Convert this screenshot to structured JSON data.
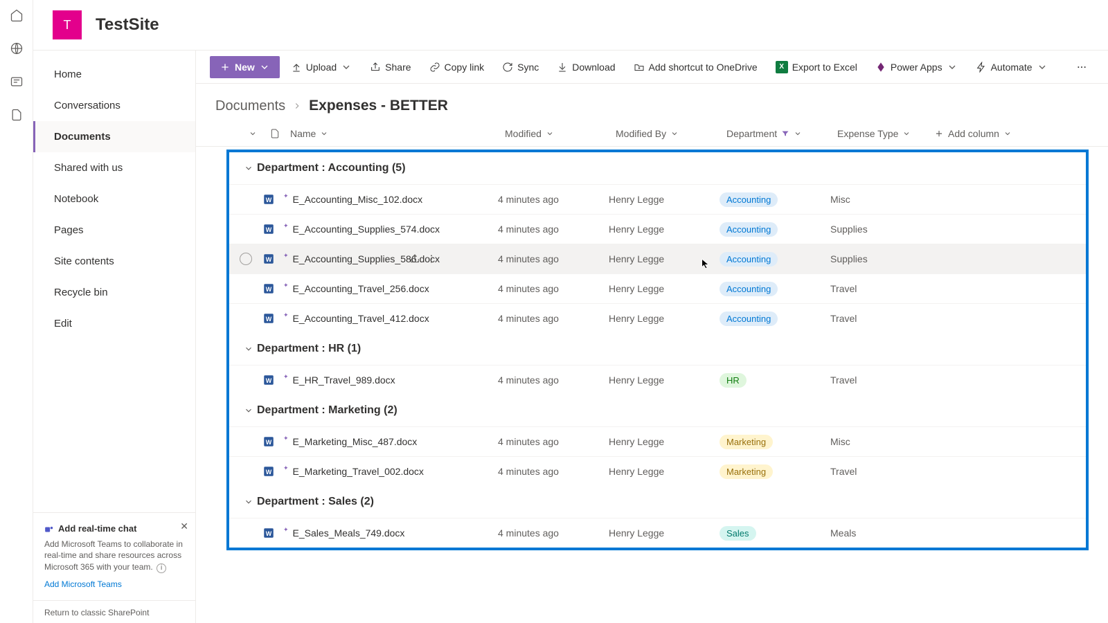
{
  "site": {
    "logoLetter": "T",
    "title": "TestSite"
  },
  "rail": [
    "home-icon",
    "globe-icon",
    "news-icon",
    "files-icon"
  ],
  "nav": {
    "items": [
      {
        "label": "Home",
        "active": false
      },
      {
        "label": "Conversations",
        "active": false
      },
      {
        "label": "Documents",
        "active": true
      },
      {
        "label": "Shared with us",
        "active": false
      },
      {
        "label": "Notebook",
        "active": false
      },
      {
        "label": "Pages",
        "active": false
      },
      {
        "label": "Site contents",
        "active": false
      },
      {
        "label": "Recycle bin",
        "active": false
      },
      {
        "label": "Edit",
        "active": false
      }
    ]
  },
  "promo": {
    "title": "Add real-time chat",
    "body": "Add Microsoft Teams to collaborate in real-time and share resources across Microsoft 365 with your team.",
    "link": "Add Microsoft Teams"
  },
  "classicLink": "Return to classic SharePoint",
  "toolbar": {
    "newLabel": "New",
    "upload": "Upload",
    "share": "Share",
    "copyLink": "Copy link",
    "sync": "Sync",
    "download": "Download",
    "shortcut": "Add shortcut to OneDrive",
    "export": "Export to Excel",
    "powerApps": "Power Apps",
    "automate": "Automate"
  },
  "breadcrumb": {
    "parent": "Documents",
    "current": "Expenses - BETTER"
  },
  "columns": {
    "name": "Name",
    "modified": "Modified",
    "modifiedBy": "Modified By",
    "department": "Department",
    "expenseType": "Expense Type",
    "addColumn": "Add column"
  },
  "groups": [
    {
      "title": "Department : Accounting (5)",
      "items": [
        {
          "name": "E_Accounting_Misc_102.docx",
          "modified": "4 minutes ago",
          "by": "Henry Legge",
          "dept": "Accounting",
          "deptClass": "accounting",
          "type": "Misc",
          "hovered": false
        },
        {
          "name": "E_Accounting_Supplies_574.docx",
          "modified": "4 minutes ago",
          "by": "Henry Legge",
          "dept": "Accounting",
          "deptClass": "accounting",
          "type": "Supplies",
          "hovered": false
        },
        {
          "name": "E_Accounting_Supplies_586.docx",
          "modified": "4 minutes ago",
          "by": "Henry Legge",
          "dept": "Accounting",
          "deptClass": "accounting",
          "type": "Supplies",
          "hovered": true
        },
        {
          "name": "E_Accounting_Travel_256.docx",
          "modified": "4 minutes ago",
          "by": "Henry Legge",
          "dept": "Accounting",
          "deptClass": "accounting",
          "type": "Travel",
          "hovered": false
        },
        {
          "name": "E_Accounting_Travel_412.docx",
          "modified": "4 minutes ago",
          "by": "Henry Legge",
          "dept": "Accounting",
          "deptClass": "accounting",
          "type": "Travel",
          "hovered": false
        }
      ]
    },
    {
      "title": "Department : HR (1)",
      "items": [
        {
          "name": "E_HR_Travel_989.docx",
          "modified": "4 minutes ago",
          "by": "Henry Legge",
          "dept": "HR",
          "deptClass": "hr",
          "type": "Travel",
          "hovered": false
        }
      ]
    },
    {
      "title": "Department : Marketing (2)",
      "items": [
        {
          "name": "E_Marketing_Misc_487.docx",
          "modified": "4 minutes ago",
          "by": "Henry Legge",
          "dept": "Marketing",
          "deptClass": "marketing",
          "type": "Misc",
          "hovered": false
        },
        {
          "name": "E_Marketing_Travel_002.docx",
          "modified": "4 minutes ago",
          "by": "Henry Legge",
          "dept": "Marketing",
          "deptClass": "marketing",
          "type": "Travel",
          "hovered": false
        }
      ]
    },
    {
      "title": "Department : Sales (2)",
      "items": [
        {
          "name": "E_Sales_Meals_749.docx",
          "modified": "4 minutes ago",
          "by": "Henry Legge",
          "dept": "Sales",
          "deptClass": "sales",
          "type": "Meals",
          "hovered": false
        }
      ]
    }
  ]
}
